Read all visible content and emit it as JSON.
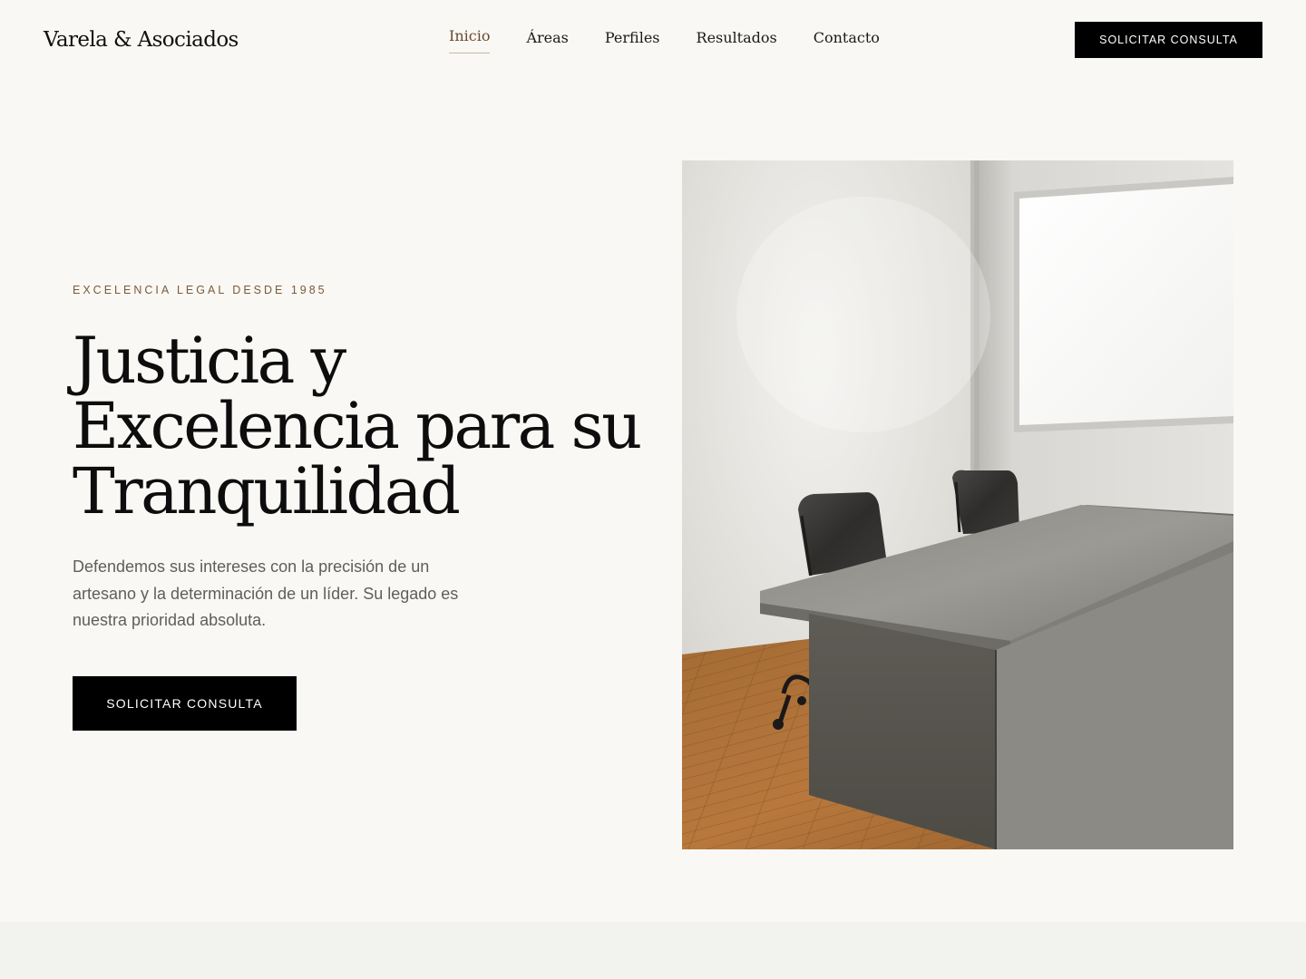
{
  "brand": {
    "name": "Varela & Asociados"
  },
  "nav": {
    "items": [
      {
        "label": "Inicio",
        "active": true
      },
      {
        "label": "Áreas",
        "active": false
      },
      {
        "label": "Perfiles",
        "active": false
      },
      {
        "label": "Resultados",
        "active": false
      },
      {
        "label": "Contacto",
        "active": false
      }
    ]
  },
  "header": {
    "cta_label": "SOLICITAR CONSULTA"
  },
  "hero": {
    "eyebrow": "EXCELENCIA LEGAL DESDE 1985",
    "title": "Justicia y Excelencia para su Tranquilidad",
    "description": "Defendemos sus intereses con la precisión de un artesano y la determinación de un líder. Su legado es nuestra prioridad absoluta.",
    "cta_label": "SOLICITAR CONSULTA",
    "image": {
      "subject": "office-meeting-room-photo"
    }
  },
  "colors": {
    "background": "#f9f8f4",
    "accent": "#7a5a3a",
    "button": "#000000",
    "button_text": "#ffffff",
    "section_band": "#f2f2ee"
  }
}
